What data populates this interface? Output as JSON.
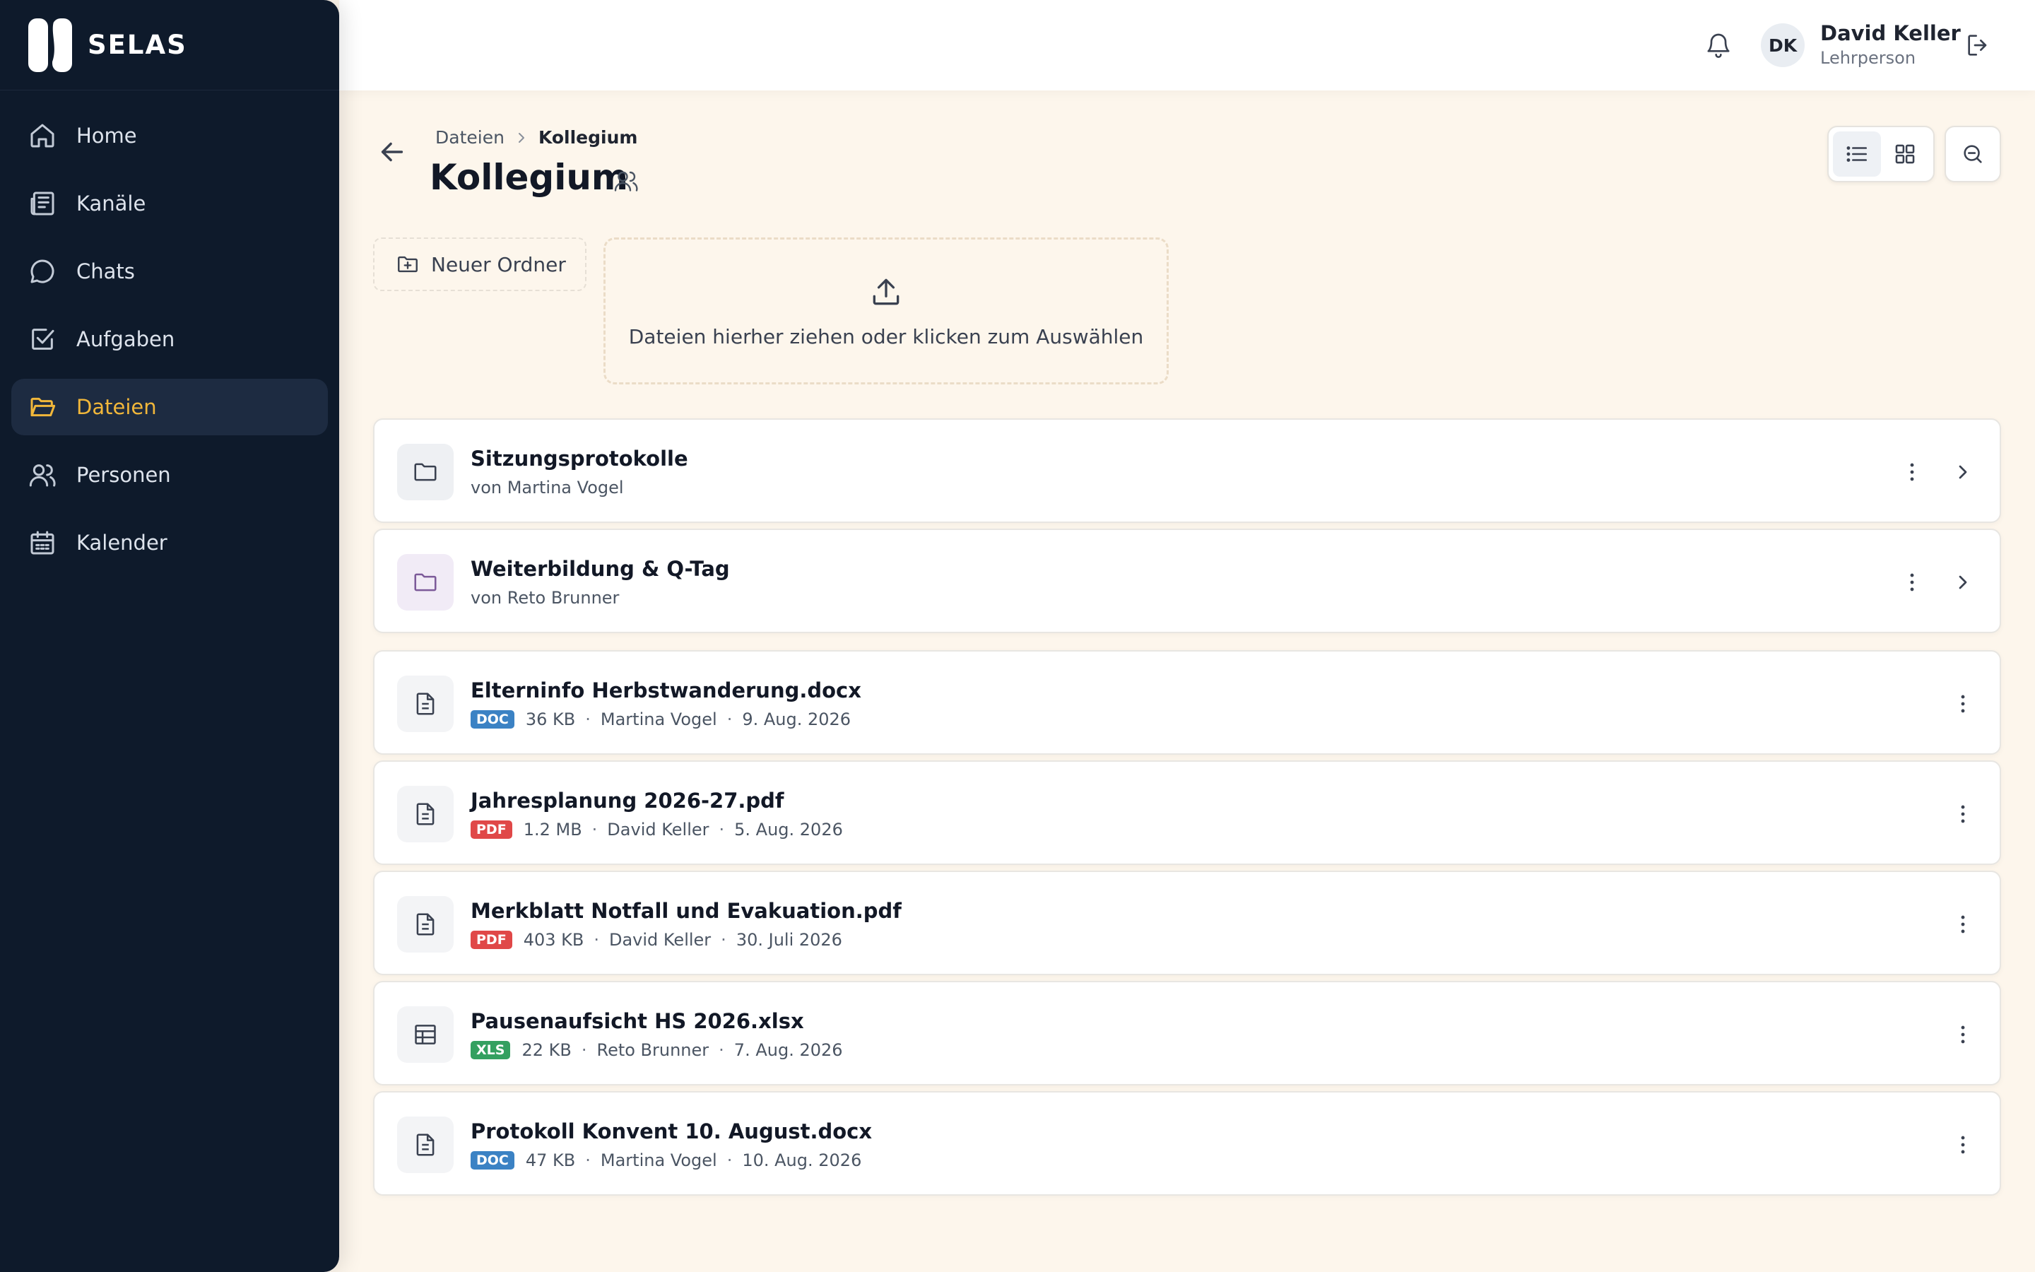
{
  "app": {
    "brand": "SELAS"
  },
  "sidebar": {
    "items": [
      {
        "label": "Home",
        "icon": "home-icon"
      },
      {
        "label": "Kanäle",
        "icon": "newspaper-icon"
      },
      {
        "label": "Chats",
        "icon": "chat-icon"
      },
      {
        "label": "Aufgaben",
        "icon": "checkbox-icon"
      },
      {
        "label": "Dateien",
        "icon": "folder-icon",
        "active": true
      },
      {
        "label": "Personen",
        "icon": "users-icon"
      },
      {
        "label": "Kalender",
        "icon": "calendar-icon"
      }
    ]
  },
  "topbar": {
    "avatar_initials": "DK",
    "user_name": "David Keller",
    "user_role": "Lehrperson"
  },
  "breadcrumb": {
    "parent": "Dateien",
    "current": "Kollegium"
  },
  "page": {
    "title": "Kollegium"
  },
  "actions": {
    "new_folder": "Neuer Ordner",
    "dropzone": "Dateien hierher ziehen oder klicken zum Auswählen"
  },
  "folders": [
    {
      "name": "Sitzungsprotokolle",
      "owner": "von Martina Vogel",
      "color": "gray"
    },
    {
      "name": "Weiterbildung & Q-Tag",
      "owner": "von Reto Brunner",
      "color": "purple"
    }
  ],
  "files": [
    {
      "name": "Elterninfo Herbstwanderung.docx",
      "type": "DOC",
      "size": "36 KB",
      "author": "Martina Vogel",
      "date": "9. Aug. 2026",
      "icon": "document-icon"
    },
    {
      "name": "Jahresplanung 2026-27.pdf",
      "type": "PDF",
      "size": "1.2 MB",
      "author": "David Keller",
      "date": "5. Aug. 2026",
      "icon": "document-icon"
    },
    {
      "name": "Merkblatt Notfall und Evakuation.pdf",
      "type": "PDF",
      "size": "403 KB",
      "author": "David Keller",
      "date": "30. Juli 2026",
      "icon": "document-icon"
    },
    {
      "name": "Pausenaufsicht HS 2026.xlsx",
      "type": "XLS",
      "size": "22 KB",
      "author": "Reto Brunner",
      "date": "7. Aug. 2026",
      "icon": "table-icon"
    },
    {
      "name": "Protokoll Konvent 10. August.docx",
      "type": "DOC",
      "size": "47 KB",
      "author": "Martina Vogel",
      "date": "10. Aug. 2026",
      "icon": "document-icon"
    }
  ],
  "colors": {
    "sidebar_bg": "#0e1a2b",
    "accent": "#f1b73a",
    "page_bg": "#fdf6ec",
    "doc_badge": "#3b82c4",
    "pdf_badge": "#e04848",
    "xls_badge": "#34a060"
  }
}
